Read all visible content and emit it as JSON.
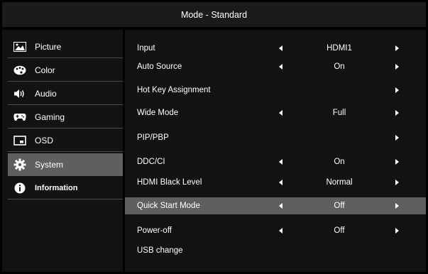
{
  "header": {
    "title": "Mode - Standard"
  },
  "sidebar": {
    "items": [
      {
        "label": "Picture",
        "icon": "picture-icon"
      },
      {
        "label": "Color",
        "icon": "palette-icon"
      },
      {
        "label": "Audio",
        "icon": "speaker-icon"
      },
      {
        "label": "Gaming",
        "icon": "gamepad-icon"
      },
      {
        "label": "OSD",
        "icon": "osd-icon"
      },
      {
        "label": "System",
        "icon": "gear-icon",
        "active": true
      },
      {
        "label": "Information",
        "icon": "info-icon"
      }
    ]
  },
  "settings": {
    "rows": [
      {
        "label": "Input",
        "value": "HDMI1"
      },
      {
        "label": "Auto Source",
        "value": "On"
      },
      {
        "label": "Hot Key Assignment",
        "value": ""
      },
      {
        "label": "Wide Mode",
        "value": "Full"
      },
      {
        "label": "PIP/PBP",
        "value": ""
      },
      {
        "label": "DDC/CI",
        "value": "On"
      },
      {
        "label": "HDMI Black Level",
        "value": "Normal"
      },
      {
        "label": "Quick Start Mode",
        "value": "Off",
        "selected": true
      },
      {
        "label": "Power-off",
        "value": "Off"
      },
      {
        "label": "USB change",
        "value": ""
      }
    ]
  },
  "colors": {
    "background": "#000000",
    "panel": "#121212",
    "highlight": "#5f5f5f",
    "text": "#ffffff"
  }
}
